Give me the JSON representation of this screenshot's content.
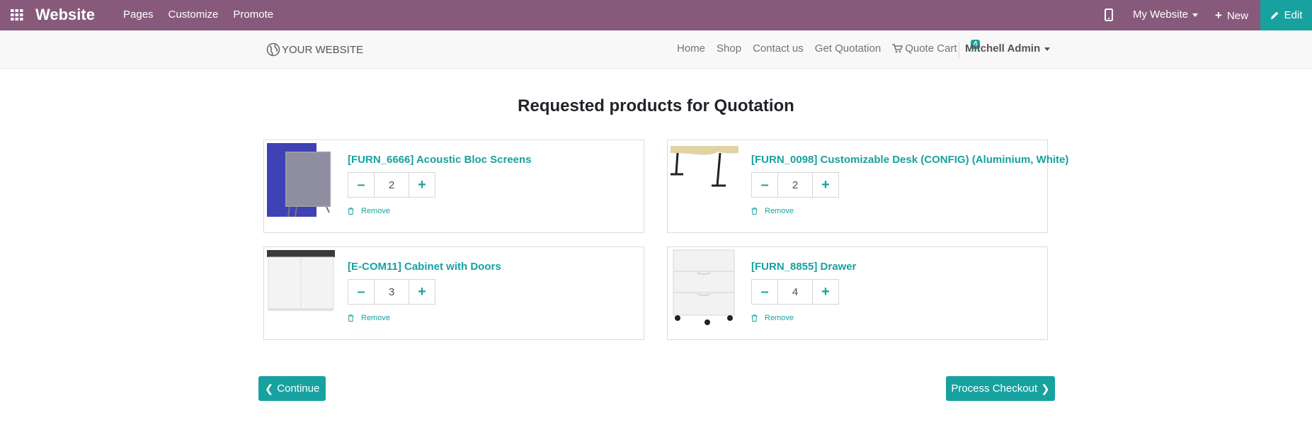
{
  "admin_bar": {
    "brand": "Website",
    "menu": [
      "Pages",
      "Customize",
      "Promote"
    ],
    "website_switcher": "My Website",
    "new_label": "New",
    "edit_label": "Edit",
    "color": "#875a7b",
    "accent": "#17a2a0"
  },
  "site_nav": {
    "logo_text": "YOUR WEBSITE",
    "links": [
      "Home",
      "Shop",
      "Contact us",
      "Get Quotation"
    ],
    "cart_label": "Quote Cart",
    "cart_count": "4",
    "user": "Mitchell Admin"
  },
  "main": {
    "title": "Requested products for Quotation",
    "products": [
      {
        "name": "[FURN_6666] Acoustic Bloc Screens",
        "qty": "2",
        "remove_label": "Remove",
        "image": "acoustic-screens-image"
      },
      {
        "name": "[FURN_0098] Customizable Desk (CONFIG) (Aluminium, White)",
        "qty": "2",
        "remove_label": "Remove",
        "image": "desk-image"
      },
      {
        "name": "[E-COM11] Cabinet with Doors",
        "qty": "3",
        "remove_label": "Remove",
        "image": "cabinet-image"
      },
      {
        "name": "[FURN_8855] Drawer",
        "qty": "4",
        "remove_label": "Remove",
        "image": "drawer-image"
      }
    ],
    "continue_label": "Continue",
    "checkout_label": "Process Checkout"
  }
}
